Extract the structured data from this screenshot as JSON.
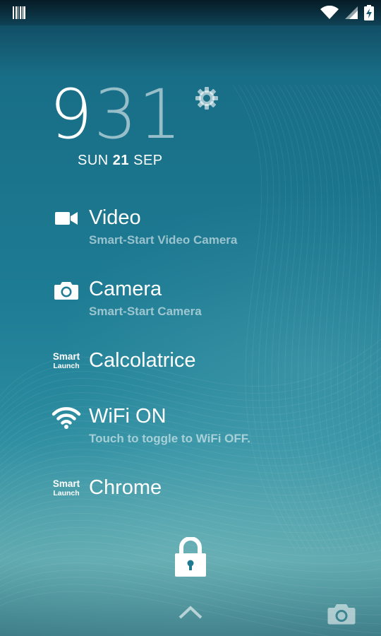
{
  "status_bar": {
    "notification_icon": "barcode-icon",
    "wifi_icon": "wifi-icon",
    "signal_icon": "cell-signal-icon",
    "battery_icon": "battery-charging-icon"
  },
  "clock": {
    "hour": "9",
    "minutes": "31",
    "day_of_week": "SUN",
    "day": "21",
    "month": "SEP"
  },
  "settings_icon": "gear-icon",
  "shortcuts": [
    {
      "icon": "video-camera-icon",
      "title": "Video",
      "subtitle": "Smart-Start Video Camera"
    },
    {
      "icon": "camera-icon",
      "title": "Camera",
      "subtitle": "Smart-Start Camera"
    },
    {
      "icon": "smart-launch-icon",
      "title": "Calcolatrice",
      "icon_text": [
        "Smart",
        "Launch"
      ]
    },
    {
      "icon": "wifi-icon",
      "title": "WiFi ON",
      "subtitle": "Touch to toggle to WiFi OFF."
    },
    {
      "icon": "smart-launch-icon",
      "title": "Chrome",
      "icon_text": [
        "Smart",
        "Launch"
      ]
    }
  ],
  "lock_icon": "padlock-icon",
  "bottom_bar": {
    "chevron_icon": "chevron-up-icon",
    "camera_icon": "camera-icon"
  },
  "colors": {
    "background_top": "#0e3f55",
    "background_mid": "#1d7b93",
    "background_bottom": "#5aa6ab",
    "text": "#ffffff",
    "subtext": "rgba(255,255,255,0.55)"
  }
}
